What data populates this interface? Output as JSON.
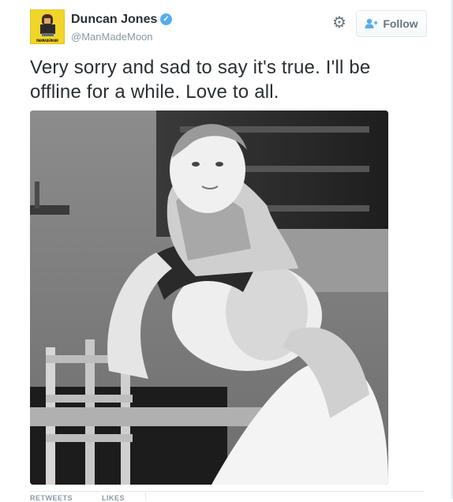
{
  "user": {
    "name": "Duncan Jones",
    "handle": "@ManMadeMoon",
    "avatar_caption": "MANMADEMOON",
    "verified": true
  },
  "actions": {
    "settings_icon": "gear-icon",
    "follow_label": "Follow",
    "follow_icon": "add-user-icon"
  },
  "tweet": {
    "text": "Very sorry and sad to say it's true.  I'll be offline for a while.  Love to all."
  },
  "stats": {
    "retweets_label": "RETWEETS",
    "likes_label": "LIKES"
  },
  "colors": {
    "accent": "#55acee",
    "text": "#292f33",
    "muted": "#8899a6",
    "avatar_bg": "#f1d52a"
  }
}
